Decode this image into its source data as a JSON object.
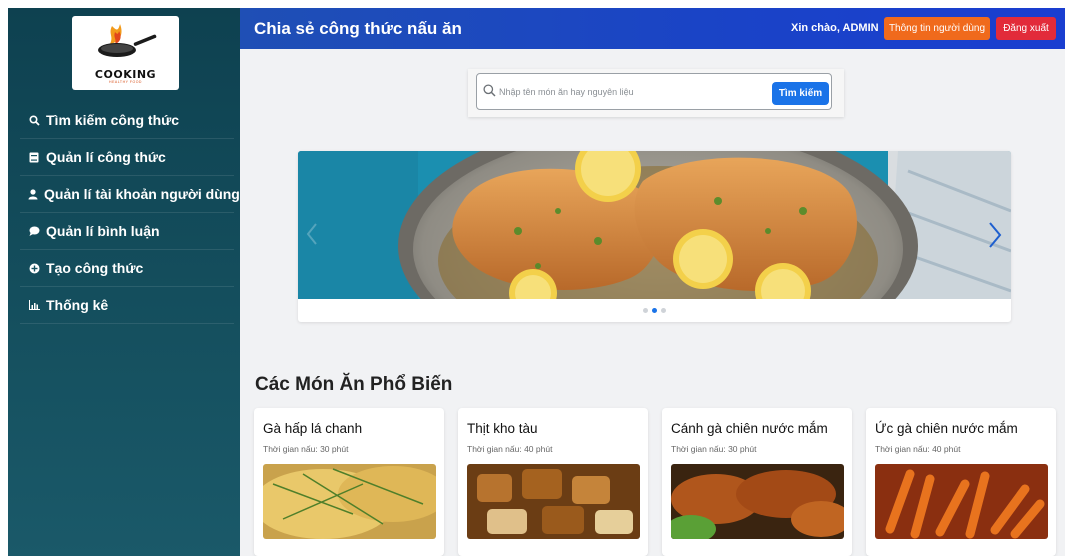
{
  "sidebar": {
    "logo": {
      "text": "COOKING",
      "subtext": "HEALTHY FOOD"
    },
    "items": [
      {
        "label": "Tìm kiếm công thức",
        "icon": "search-icon"
      },
      {
        "label": "Quản lí công thức",
        "icon": "book-icon"
      },
      {
        "label": "Quản lí tài khoản người dùng",
        "icon": "user-icon"
      },
      {
        "label": "Quản lí bình luận",
        "icon": "comment-icon"
      },
      {
        "label": "Tạo công thức",
        "icon": "plus-circle-icon"
      },
      {
        "label": "Thống kê",
        "icon": "chart-icon"
      }
    ]
  },
  "header": {
    "title": "Chia sẻ công thức nấu ăn",
    "greeting": "Xin chào, ADMIN",
    "profile_button": "Thông tin người dùng",
    "logout_button": "Đăng xuất",
    "colors": {
      "profile": "#f06a1c",
      "logout": "#e22b3a"
    }
  },
  "search": {
    "placeholder": "Nhập tên món ăn hay nguyên liệu",
    "value": "",
    "button": "Tìm kiếm"
  },
  "carousel": {
    "slide_count": 3,
    "active_index": 1
  },
  "popular": {
    "title": "Các Món Ăn Phổ Biến",
    "recipes": [
      {
        "name": "Gà hấp lá chanh",
        "time": "Thời gian nấu: 30 phút"
      },
      {
        "name": "Thịt kho tàu",
        "time": "Thời gian nấu: 40 phút"
      },
      {
        "name": "Cánh gà chiên nước mắm",
        "time": "Thời gian nấu: 30 phút"
      },
      {
        "name": "Ức gà chiên nước mắm",
        "time": "Thời gian nấu: 40 phút"
      }
    ]
  }
}
